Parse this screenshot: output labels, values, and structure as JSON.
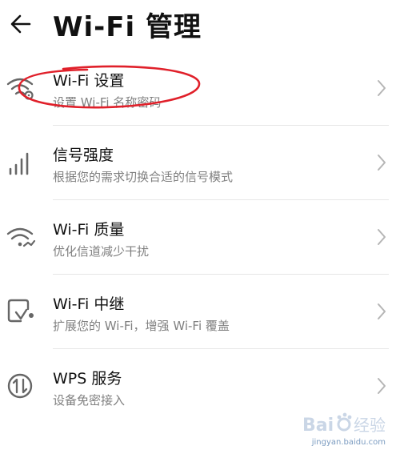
{
  "header": {
    "title": "Wi-Fi 管理",
    "back_icon": "arrow-left-icon"
  },
  "items": [
    {
      "label": "Wi-Fi 设置",
      "subtitle": "设置 Wi-Fi 名称密码",
      "icon": "wifi-settings-icon"
    },
    {
      "label": "信号强度",
      "subtitle": "根据您的需求切换合适的信号模式",
      "icon": "signal-bars-icon"
    },
    {
      "label": "Wi-Fi 质量",
      "subtitle": "优化信道减少干扰",
      "icon": "wifi-quality-icon"
    },
    {
      "label": "Wi-Fi 中继",
      "subtitle": "扩展您的 Wi-Fi，增强 Wi-Fi 覆盖",
      "icon": "wifi-relay-icon"
    },
    {
      "label": "WPS 服务",
      "subtitle": "设备免密接入",
      "icon": "wps-icon"
    }
  ],
  "annotation_color": "#e0202a",
  "watermark": {
    "logo_text": "Bai 经验",
    "url": "jingyan.baidu.com"
  }
}
